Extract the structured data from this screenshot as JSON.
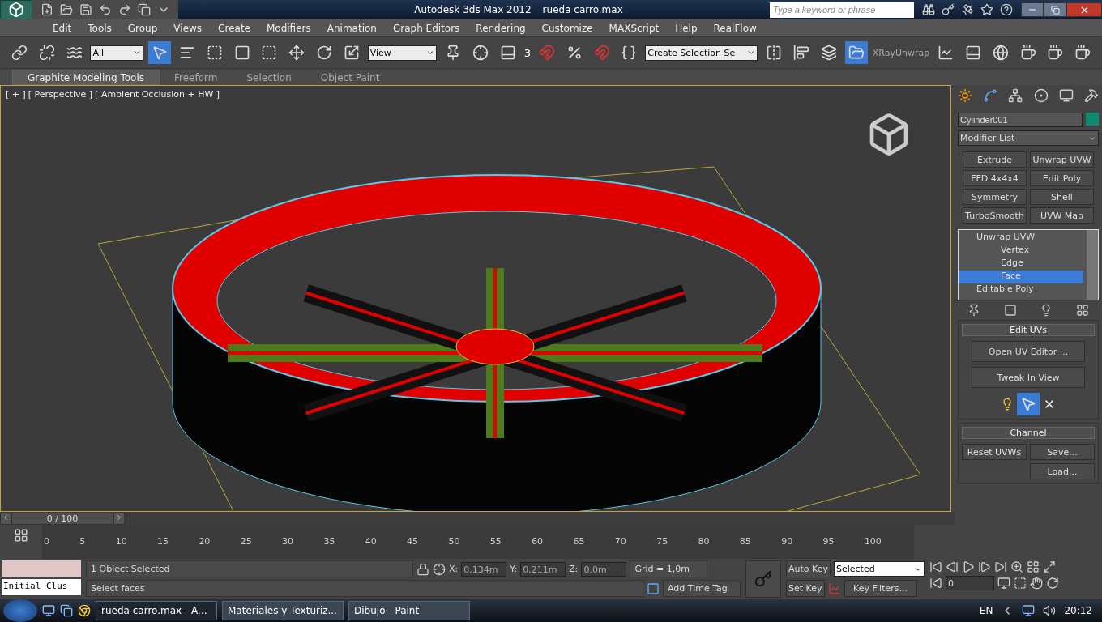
{
  "title_bar": {
    "app_title": "Autodesk 3ds Max  2012",
    "file_name": "rueda carro.max",
    "search": {
      "placeholder": "Type a keyword or phrase"
    }
  },
  "menu": [
    "Edit",
    "Tools",
    "Group",
    "Views",
    "Create",
    "Modifiers",
    "Animation",
    "Graph Editors",
    "Rendering",
    "Customize",
    "MAXScript",
    "Help",
    "RealFlow"
  ],
  "toolbar": {
    "selection_filter": "All",
    "reference_coord": "View",
    "snap_label": "3",
    "named_selection": "Create Selection Se",
    "xray_label": "XRayUnwrap"
  },
  "ribbon_tabs": [
    {
      "label": "Graphite Modeling Tools",
      "selected": true
    },
    {
      "label": "Freeform",
      "selected": false
    },
    {
      "label": "Selection",
      "selected": false
    },
    {
      "label": "Object Paint",
      "selected": false
    }
  ],
  "viewport": {
    "labels": [
      "[ + ]",
      "[ Perspective ]",
      "[ Ambient Occlusion + HW ]"
    ]
  },
  "command_panel": {
    "object_name": "Cylinder001",
    "modifier_list": "Modifier List",
    "modifier_buttons": [
      "Extrude",
      "Unwrap UVW",
      "FFD 4x4x4",
      "Edit Poly",
      "Symmetry",
      "Shell",
      "TurboSmooth",
      "UVW Map"
    ],
    "stack": [
      {
        "label": "Unwrap UVW",
        "selected": false,
        "children": [
          {
            "label": "Vertex",
            "selected": false
          },
          {
            "label": "Edge",
            "selected": false
          },
          {
            "label": "Face",
            "selected": true
          }
        ]
      },
      {
        "label": "Editable Poly",
        "selected": false
      }
    ],
    "edit_uvs": {
      "title": "Edit UVs",
      "buttons": [
        "Open UV Editor ...",
        "Tweak In View"
      ]
    },
    "channel": {
      "title": "Channel",
      "buttons": [
        "Reset UVWs",
        "Save...",
        "Load..."
      ]
    }
  },
  "timeline": {
    "frame": "0 / 100",
    "level": 0,
    "ticks": [
      "0",
      "5",
      "10",
      "15",
      "20",
      "25",
      "30",
      "35",
      "40",
      "45",
      "50",
      "55",
      "60",
      "65",
      "70",
      "75",
      "80",
      "85",
      "90",
      "95",
      "100"
    ]
  },
  "status": {
    "named_set": "Initial Clus",
    "objects": "1 Object Selected",
    "prompt": "Select faces",
    "x_label": "X:",
    "x": "0,134m",
    "y_label": "Y:",
    "y": "0,211m",
    "z_label": "Z:",
    "z": "0,0m",
    "grid": "Grid = 1,0m",
    "add_time_tag": "Add Time Tag",
    "auto_key": "Auto Key",
    "set_key": "Set Key",
    "key_mode": "Selected",
    "key_filters": "Key Filters...",
    "frame": "0"
  },
  "taskbar": {
    "tasks": [
      {
        "label": "rueda carro.max - A...",
        "selected": true
      },
      {
        "label": "Materiales y Texturiz...",
        "selected": false
      },
      {
        "label": "Dibujo - Paint",
        "selected": false
      }
    ],
    "language": "EN",
    "time": "20:12"
  }
}
